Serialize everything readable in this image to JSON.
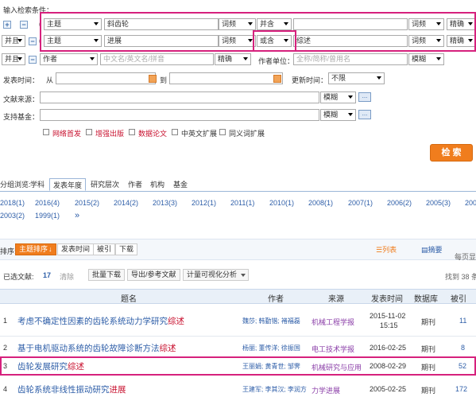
{
  "header": {
    "input_label": "输入检索条件："
  },
  "rows": [
    {
      "logic": "",
      "field": "主题",
      "term1": "斜齿轮",
      "freq1": "词频",
      "op": "并含",
      "term2": "",
      "freq2": "词频",
      "match": "精确"
    },
    {
      "logic": "并且",
      "field": "主题",
      "term1": "进展",
      "freq1": "词频",
      "op": "或含",
      "term2": "综述",
      "freq2": "词频",
      "match": "精确"
    }
  ],
  "author_row": {
    "logic": "并且",
    "field": "作者",
    "placeholder": "中文名/英文名/拼音",
    "match": "精确",
    "unit_label": "作者单位：",
    "unit_placeholder": "全称/简称/曾用名",
    "unit_match": "模糊"
  },
  "time_row": {
    "label": "发表时间：",
    "from": "从",
    "to": "到",
    "update_label": "更新时间：",
    "update_value": "不限"
  },
  "source_row": {
    "label": "文献来源：",
    "match": "模糊"
  },
  "fund_row": {
    "label": "支持基金：",
    "match": "模糊"
  },
  "dots": "...",
  "checks": [
    "网络首发",
    "增强出版",
    "数据论文",
    "中英文扩展",
    "同义词扩展"
  ],
  "search_button": "检 索",
  "group_tabs": {
    "prefix": "分组浏览:",
    "tabs": [
      "学科",
      "发表年度",
      "研究层次",
      "作者",
      "机构",
      "基金"
    ]
  },
  "years_row1": [
    "2018(1)",
    "2016(4)",
    "2015(2)",
    "2014(2)",
    "2013(3)",
    "2012(1)",
    "2011(1)",
    "2010(1)",
    "2008(1)",
    "2007(1)",
    "2006(2)",
    "2005(3)",
    "2004(1)"
  ],
  "years_row2": [
    "2003(2)",
    "1999(1)",
    "»"
  ],
  "sort": {
    "label": "排序:",
    "options": [
      "主题排序",
      "发表时间",
      "被引",
      "下载"
    ],
    "list_view": "列表",
    "abstract_view": "摘要",
    "per_page": "每页显"
  },
  "toolbar": {
    "selected_label": "已选文献:",
    "selected_count": "17",
    "clear": "清除",
    "buttons": [
      "批量下载",
      "导出/参考文献",
      "计量可视化分析"
    ],
    "found": "找到 38 条"
  },
  "table": {
    "headers": [
      "题名",
      "作者",
      "来源",
      "发表时间",
      "数据库",
      "被引"
    ],
    "rows": [
      {
        "no": "1",
        "title_pre": "考虑不确定性因素的齿轮系统动力学研究",
        "title_hl": "综述",
        "title_post": "",
        "authors": "魏莎; 韩勤锴; 褚福磊",
        "source": "机械工程学报",
        "date1": "2015-11-02",
        "date2": "15:15",
        "db": "期刊",
        "cite": "11"
      },
      {
        "no": "2",
        "title_pre": "基于电机驱动系统的齿轮故障诊断方法",
        "title_hl": "综述",
        "title_post": "",
        "authors": "杨丽; 董传洋; 徐振国",
        "source": "电工技术学报",
        "date1": "2016-02-25",
        "date2": "",
        "db": "期刊",
        "cite": "8"
      },
      {
        "no": "3",
        "title_pre": "齿轮发展研究",
        "title_hl": "综述",
        "title_post": "",
        "authors": "王丽娟; 黄青世; 邹霁",
        "source": "机械研究与应用",
        "date1": "2008-02-29",
        "date2": "",
        "db": "期刊",
        "cite": "52"
      },
      {
        "no": "4",
        "title_pre": "齿轮系统非线性振动研究",
        "title_hl": "进展",
        "title_post": "",
        "authors": "王建军; 李其汉; 李润方",
        "source": "力学进展",
        "date1": "2005-02-25",
        "date2": "",
        "db": "期刊",
        "cite": "172"
      }
    ]
  },
  "colors": {
    "accent_orange": "#f07d1d",
    "highlight_pink": "#d6217d",
    "link_blue": "#2e5ea8",
    "keyword_red": "#c8102e"
  }
}
